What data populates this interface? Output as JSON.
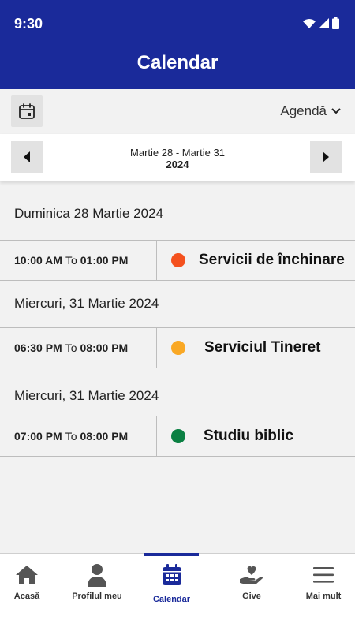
{
  "status": {
    "time": "9:30"
  },
  "header": {
    "title": "Calendar"
  },
  "toolbar": {
    "view_selected": "Agendă"
  },
  "date_nav": {
    "range": "Martie 28 - Martie 31",
    "year": "2024"
  },
  "days": [
    {
      "header": "Duminica 28 Martie 2024",
      "event": {
        "start": "10:00 AM",
        "to": "To",
        "end": "01:00 PM",
        "title": "Servicii de închinare",
        "color": "#f4511e"
      }
    },
    {
      "header": "Miercuri, 31 Martie 2024",
      "event": {
        "start": "06:30 PM",
        "to": "To",
        "end": "08:00 PM",
        "title": "Serviciul Tineret",
        "color": "#f9a825"
      }
    },
    {
      "header": "Miercuri, 31 Martie 2024",
      "event": {
        "start": "07:00 PM",
        "to": "To",
        "end": "08:00 PM",
        "title": "Studiu biblic",
        "color": "#0b8043"
      }
    }
  ],
  "bottom_nav": {
    "tabs": [
      {
        "label": "Acasă",
        "icon": "home-icon"
      },
      {
        "label": "Profilul meu",
        "icon": "person-icon"
      },
      {
        "label": "Calendar",
        "icon": "calendar-icon",
        "active": true
      },
      {
        "label": "Give",
        "icon": "give-hand-heart-icon"
      },
      {
        "label": "Mai mult",
        "icon": "menu-icon"
      }
    ]
  },
  "colors": {
    "primary": "#1a2a9a",
    "background": "#f2f2f2"
  }
}
